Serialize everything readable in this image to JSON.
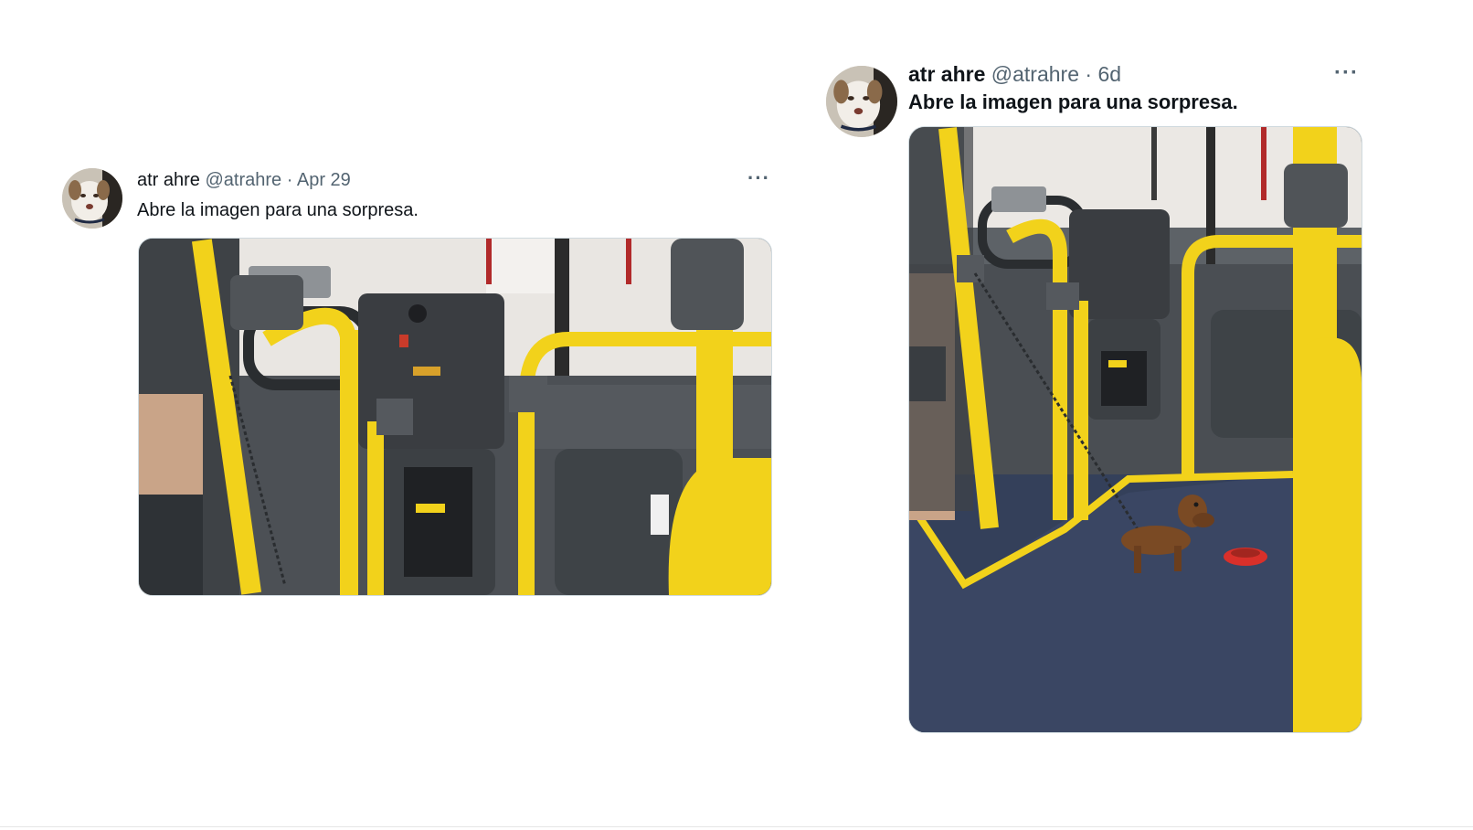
{
  "tweets": [
    {
      "author_name": "atr ahre",
      "handle": "@atrahre",
      "separator": "·",
      "timestamp": "Apr 29",
      "text": "Abre la imagen para una sorpresa.",
      "more_label": "···",
      "avatar_icon": "dog-avatar-icon",
      "media_icon": "bus-interior-photo"
    },
    {
      "author_name": "atr ahre",
      "handle": "@atrahre",
      "separator": "·",
      "timestamp": "6d",
      "text": "Abre la imagen para una sorpresa.",
      "more_label": "···",
      "avatar_icon": "dog-avatar-icon",
      "media_icon": "bus-interior-with-dog-photo"
    }
  ],
  "colors": {
    "text_primary": "#0f1419",
    "text_secondary": "#536471",
    "pole_yellow": "#f2d21b",
    "bus_floor": "#34405a",
    "divider": "#e6e6e6"
  }
}
